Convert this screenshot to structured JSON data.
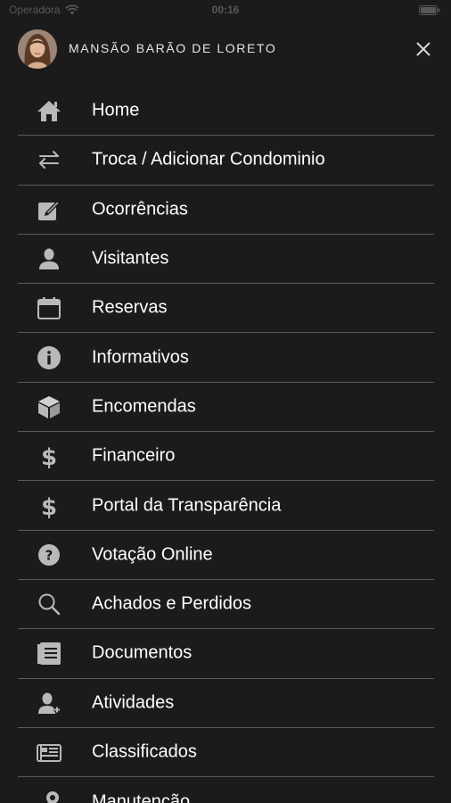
{
  "status_bar": {
    "carrier": "Operadora",
    "time": "00:16"
  },
  "header": {
    "title": "MANSÃO BARÃO DE LORETO"
  },
  "colors": {
    "background": "#1b1b1b",
    "icon": "#b9b9b9",
    "divider": "#5a5a5a"
  },
  "menu": {
    "items": [
      {
        "label": "Home",
        "icon": "home-icon"
      },
      {
        "label": "Troca / Adicionar Condominio",
        "icon": "swap-icon"
      },
      {
        "label": "Ocorrências",
        "icon": "edit-icon"
      },
      {
        "label": "Visitantes",
        "icon": "person-icon"
      },
      {
        "label": "Reservas",
        "icon": "calendar-icon"
      },
      {
        "label": "Informativos",
        "icon": "info-icon"
      },
      {
        "label": "Encomendas",
        "icon": "package-icon"
      },
      {
        "label": "Financeiro",
        "icon": "dollar-icon"
      },
      {
        "label": "Portal da Transparência",
        "icon": "dollar-icon"
      },
      {
        "label": "Votação Online",
        "icon": "question-icon"
      },
      {
        "label": "Achados e Perdidos",
        "icon": "search-icon"
      },
      {
        "label": "Documentos",
        "icon": "document-icon"
      },
      {
        "label": "Atividades",
        "icon": "person-add-icon"
      },
      {
        "label": "Classificados",
        "icon": "newspaper-icon"
      },
      {
        "label": "Manutenção",
        "icon": "tools-icon"
      }
    ]
  }
}
